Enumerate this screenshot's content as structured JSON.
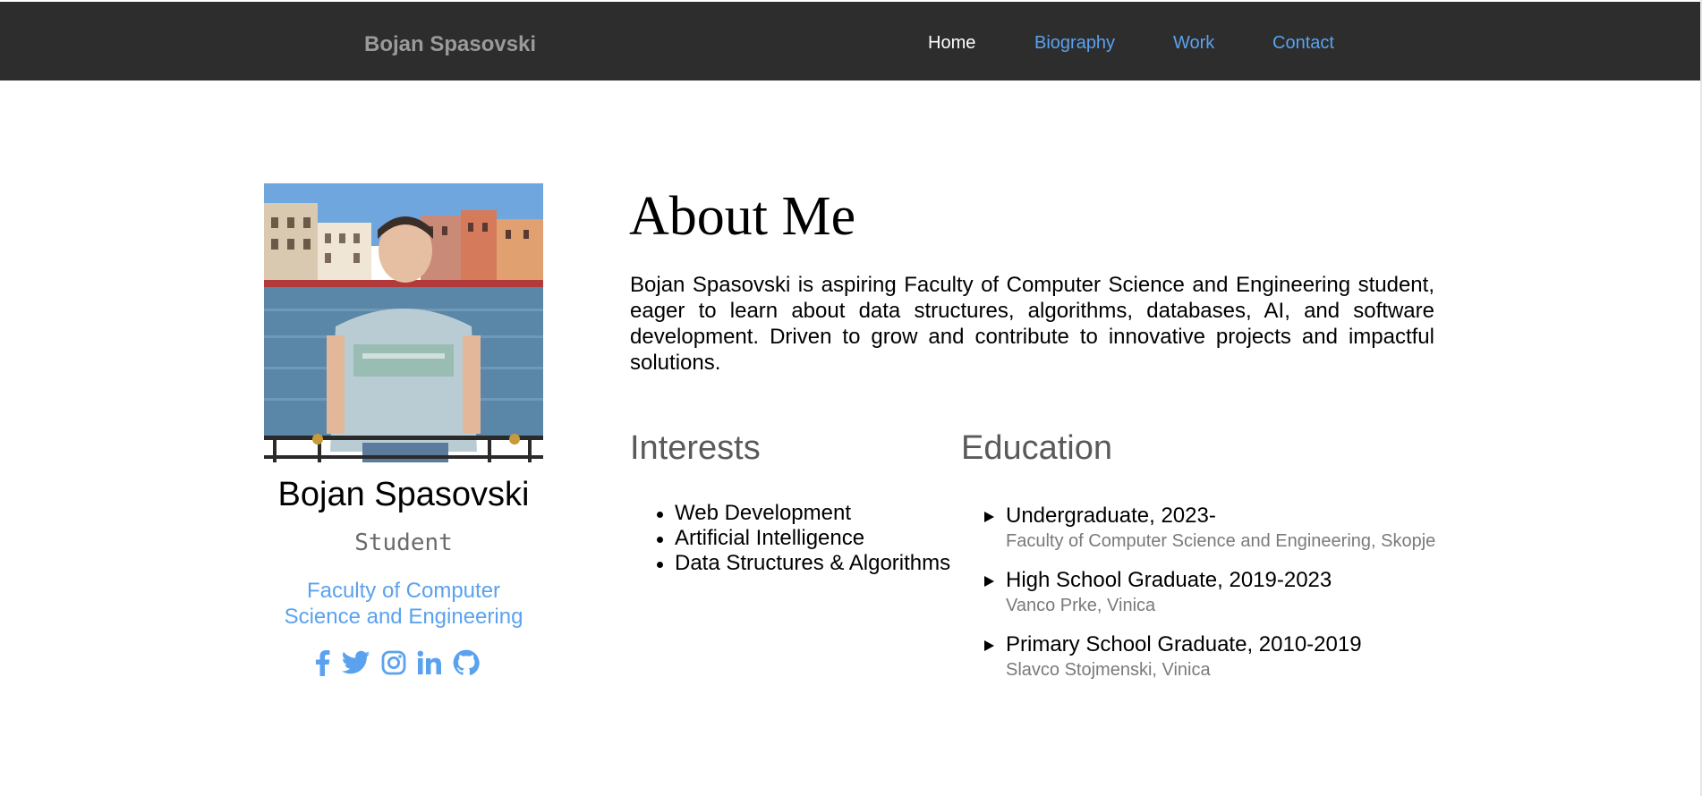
{
  "header": {
    "brand": "Bojan Spasovski",
    "nav": [
      {
        "label": "Home",
        "active": true
      },
      {
        "label": "Biography",
        "active": false
      },
      {
        "label": "Work",
        "active": false
      },
      {
        "label": "Contact",
        "active": false
      }
    ]
  },
  "profile": {
    "name": "Bojan Spasovski",
    "role": "Student",
    "school_line1": "Faculty of Computer",
    "school_line2": "Science and Engineering",
    "socials": [
      "facebook-icon",
      "twitter-icon",
      "instagram-icon",
      "linkedin-icon",
      "github-icon"
    ]
  },
  "about": {
    "title": "About Me",
    "text": "Bojan Spasovski is aspiring Faculty of Computer Science and Engineering student, eager to learn about data structures, algorithms, databases, AI, and software development. Driven to grow and contribute to innovative projects and impactful solutions."
  },
  "interests": {
    "heading": "Interests",
    "items": [
      "Web Development",
      "Artificial Intelligence",
      "Data Structures & Algorithms"
    ]
  },
  "education": {
    "heading": "Education",
    "items": [
      {
        "title": "Undergraduate, 2023-",
        "place": "Faculty of Computer Science and Engineering, Skopje"
      },
      {
        "title": "High School Graduate, 2019-2023",
        "place": "Vanco Prke, Vinica"
      },
      {
        "title": "Primary School Graduate, 2010-2019",
        "place": "Slavco Stojmenski, Vinica"
      }
    ]
  },
  "colors": {
    "navbar": "#2d2d2d",
    "link": "#5aa2ef",
    "muted": "#7a7a7a"
  }
}
